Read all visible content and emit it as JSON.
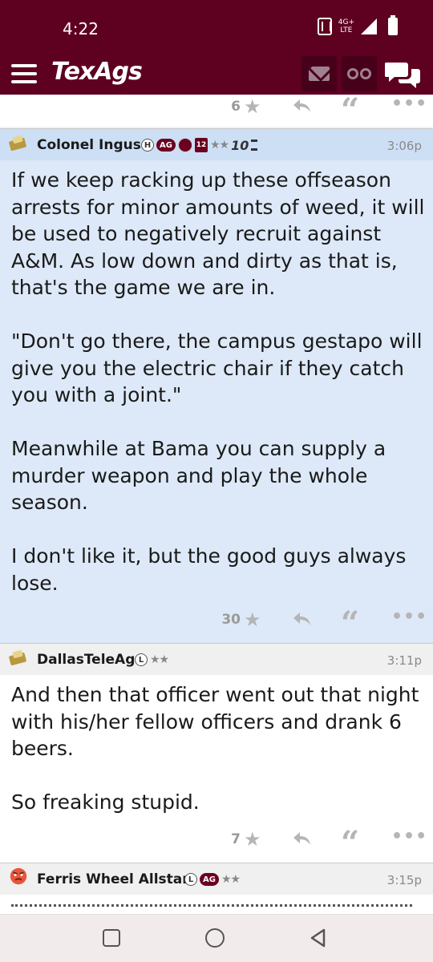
{
  "status_bar": {
    "time": "4:22",
    "network_label_top": "4G+",
    "network_label_bottom": "LTE"
  },
  "app_header": {
    "logo": "TexAgs",
    "bg_color": "#5e0020"
  },
  "previous_post": {
    "star_count": "6"
  },
  "posts": [
    {
      "author": "Colonel Ingus",
      "badges": [
        "H",
        "AG",
        "12",
        "★★",
        "10"
      ],
      "time": "3:06p",
      "body": "If we keep racking up these offseason\narrests for minor amounts of weed, it will\nbe used to negatively recruit against\nA&M. As low down and dirty as that is,\nthat's the game we are in.\n\n\"Don't go there, the campus gestapo will\ngive you the electric chair if they catch\nyou with a joint.\"\n\nMeanwhile at Bama you can supply a\nmurder weapon and play the whole\nseason.\n\nI don't like it, but the good guys always\nlose.",
      "star_count": "30",
      "bg_color": "#dde9f8"
    },
    {
      "author": "DallasTeleAg",
      "badges": [
        "L",
        "★★"
      ],
      "time": "3:11p",
      "body": "And then that officer went out that night\nwith his/her fellow officers and drank 6\nbeers.\n\nSo freaking stupid.",
      "star_count": "7",
      "bg_color": "#ffffff"
    },
    {
      "author": "Ferris Wheel Allstar",
      "badges": [
        "L",
        "AG",
        "★★"
      ],
      "time": "3:15p"
    }
  ],
  "icons": {
    "menu": "hamburger-menu-icon",
    "mail": "mail-icon",
    "binoculars": "binoculars-icon",
    "chat": "chat-bubbles-icon",
    "star": "star-icon",
    "reply": "reply-icon",
    "quote": "quote-icon",
    "more": "more-icon"
  }
}
